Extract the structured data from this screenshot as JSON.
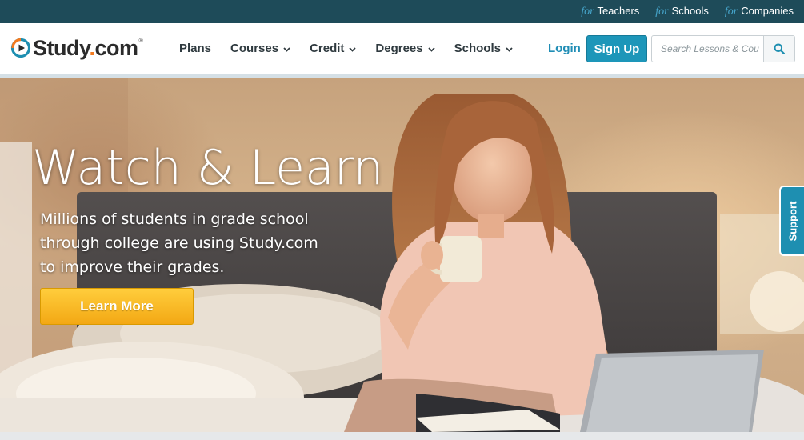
{
  "topbar": {
    "links": [
      {
        "prefix": "for",
        "label": "Teachers"
      },
      {
        "prefix": "for",
        "label": "Schools"
      },
      {
        "prefix": "for",
        "label": "Companies"
      }
    ],
    "background": "#1e4b59",
    "prefix_color": "#46a6cc"
  },
  "header": {
    "logo": {
      "name": "Study",
      "dot": ".",
      "suffix": "com",
      "tm": "®"
    },
    "nav": [
      {
        "label": "Plans",
        "dropdown": false
      },
      {
        "label": "Courses",
        "dropdown": true
      },
      {
        "label": "Credit",
        "dropdown": true
      },
      {
        "label": "Degrees",
        "dropdown": true
      },
      {
        "label": "Schools",
        "dropdown": true
      }
    ],
    "login_label": "Login",
    "signup_label": "Sign Up",
    "search": {
      "placeholder": "Search Lessons & Cou",
      "value": "",
      "icon": "search-icon"
    },
    "accent": "#1d96b9"
  },
  "hero": {
    "title": "Watch & Learn",
    "subtitle_lines": [
      "Millions of students in grade school",
      "through college are using Study.com",
      "to improve their grades."
    ],
    "cta_label": "Learn More",
    "cta_color": "#f6b21e"
  },
  "support": {
    "label": "Support"
  }
}
